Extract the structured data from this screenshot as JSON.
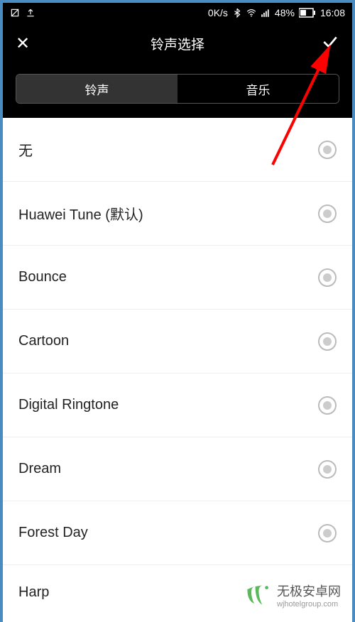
{
  "status_bar": {
    "speed": "0K/s",
    "battery_pct": "48%",
    "time": "16:08"
  },
  "header": {
    "title": "铃声选择"
  },
  "tabs": {
    "ringtone": "铃声",
    "music": "音乐"
  },
  "ringtones": [
    {
      "label": "无"
    },
    {
      "label": "Huawei Tune (默认)"
    },
    {
      "label": "Bounce"
    },
    {
      "label": "Cartoon"
    },
    {
      "label": "Digital Ringtone"
    },
    {
      "label": "Dream"
    },
    {
      "label": "Forest Day"
    },
    {
      "label": "Harp"
    }
  ],
  "watermark": {
    "main": "无极安卓网",
    "sub": "wjhotelgroup.com"
  }
}
